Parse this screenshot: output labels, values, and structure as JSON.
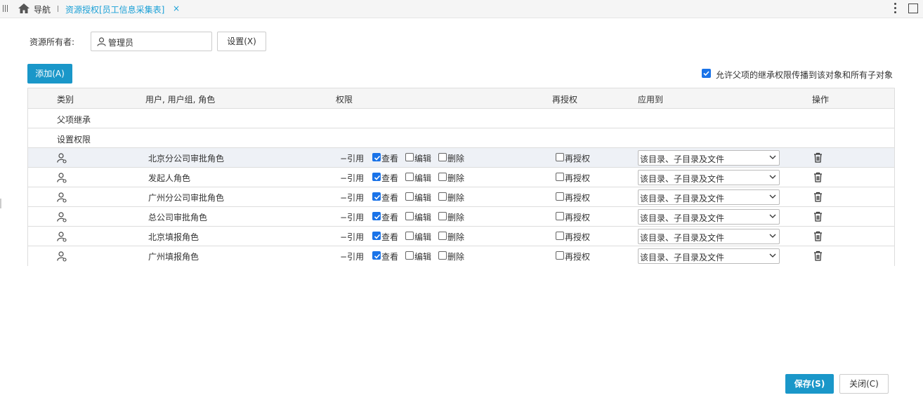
{
  "topbar": {
    "nav_label": "导航",
    "active_tab": "资源授权[员工信息采集表]",
    "close_glyph": "×",
    "icons": [
      "grip-icon",
      "home-icon",
      "close-icon",
      "more-vertical-icon",
      "maximize-icon"
    ]
  },
  "owner": {
    "label": "资源所有者:",
    "value": "管理员",
    "set_button": "设置(X)"
  },
  "toolbar": {
    "add_button": "添加(A)",
    "inherit_label": "允许父项的继承权限传播到该对象和所有子对象",
    "inherit_checked": true
  },
  "table": {
    "headers": {
      "type": "类别",
      "users": "用户, 用户组, 角色",
      "permission": "权限",
      "regrant": "再授权",
      "apply_to": "应用到",
      "action": "操作"
    },
    "sections": {
      "inherited": "父项继承",
      "set": "设置权限"
    },
    "perm_labels": {
      "ref": "引用",
      "view": "查看",
      "edit": "编辑",
      "delete": "删除",
      "regrant": "再授权"
    },
    "rows": [
      {
        "name": "北京分公司审批角色",
        "view": true,
        "edit": false,
        "delete": false,
        "regrant": false,
        "apply_to": "该目录、子目录及文件"
      },
      {
        "name": "发起人角色",
        "view": true,
        "edit": false,
        "delete": false,
        "regrant": false,
        "apply_to": "该目录、子目录及文件"
      },
      {
        "name": "广州分公司审批角色",
        "view": true,
        "edit": false,
        "delete": false,
        "regrant": false,
        "apply_to": "该目录、子目录及文件"
      },
      {
        "name": "总公司审批角色",
        "view": true,
        "edit": false,
        "delete": false,
        "regrant": false,
        "apply_to": "该目录、子目录及文件"
      },
      {
        "name": "北京填报角色",
        "view": true,
        "edit": false,
        "delete": false,
        "regrant": false,
        "apply_to": "该目录、子目录及文件"
      },
      {
        "name": "广州填报角色",
        "view": true,
        "edit": false,
        "delete": false,
        "regrant": false,
        "apply_to": "该目录、子目录及文件"
      }
    ]
  },
  "footer": {
    "save_button": "保存(S)",
    "close_button": "关闭(C)"
  },
  "colors": {
    "accent": "#1a97c9",
    "tab_active": "#1aa0d6",
    "checkbox_on": "#1a73e8"
  }
}
